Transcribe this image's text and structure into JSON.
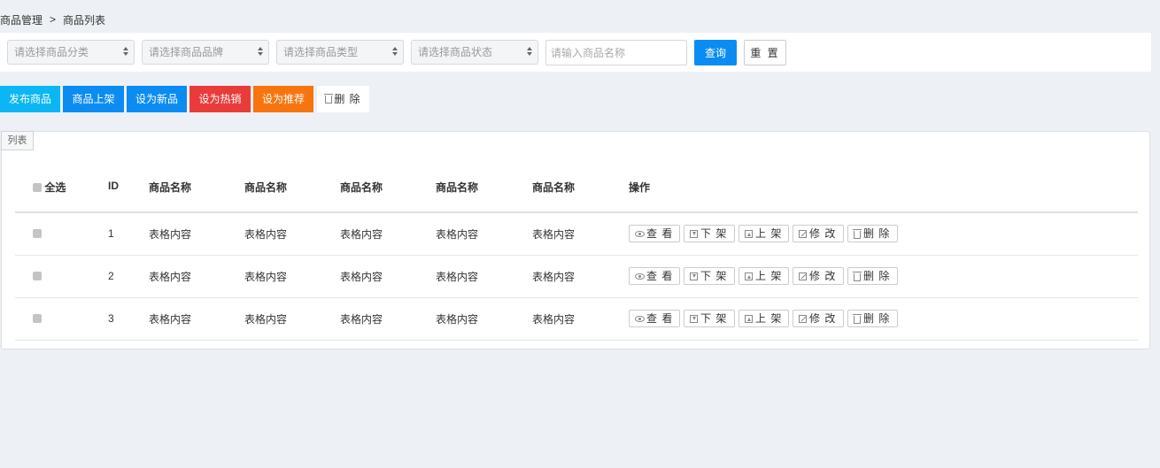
{
  "breadcrumb": {
    "parent": "商品管理",
    "separator": ">",
    "current": "商品列表"
  },
  "filters": {
    "category_placeholder": "请选择商品分类",
    "brand_placeholder": "请选择商品品牌",
    "type_placeholder": "请选择商品类型",
    "status_placeholder": "请选择商品状态",
    "name_placeholder": "请输入商品名称",
    "query_label": "查询",
    "reset_label": "重 置"
  },
  "actions": {
    "publish": "发布商品",
    "on_shelf": "商品上架",
    "set_new": "设为新品",
    "set_hot": "设为热销",
    "set_recommend": "设为推荐",
    "delete": "删 除"
  },
  "panel": {
    "tag": "列表"
  },
  "table": {
    "headers": [
      "全选",
      "ID",
      "商品名称",
      "商品名称",
      "商品名称",
      "商品名称",
      "商品名称",
      "操作"
    ],
    "rows": [
      {
        "id": "1",
        "cells": [
          "表格内容",
          "表格内容",
          "表格内容",
          "表格内容",
          "表格内容"
        ]
      },
      {
        "id": "2",
        "cells": [
          "表格内容",
          "表格内容",
          "表格内容",
          "表格内容",
          "表格内容"
        ]
      },
      {
        "id": "3",
        "cells": [
          "表格内容",
          "表格内容",
          "表格内容",
          "表格内容",
          "表格内容"
        ]
      }
    ],
    "row_ops": {
      "view": "查 看",
      "off_shelf": "下 架",
      "on_shelf": "上 架",
      "edit": "修 改",
      "delete": "删 除"
    }
  },
  "colors": {
    "primary": "#0b8cf2",
    "info": "#0bb6f4",
    "danger": "#ea3b3b",
    "warning": "#f7750e",
    "page_bg": "#edf0f4"
  }
}
